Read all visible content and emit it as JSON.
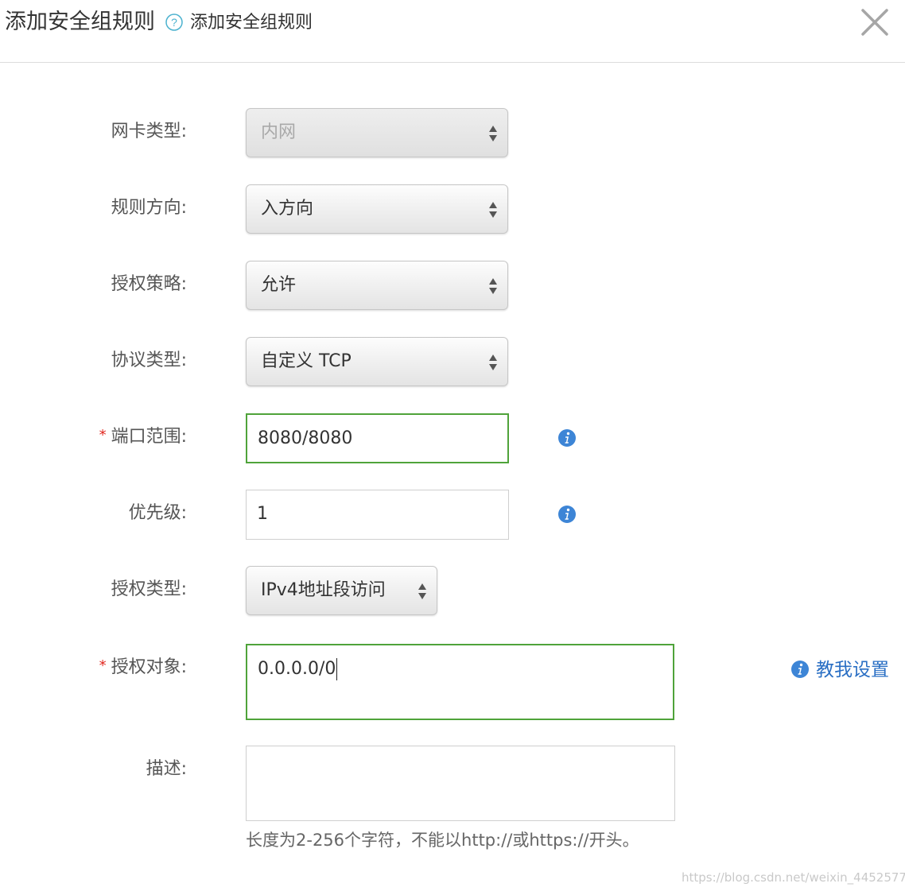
{
  "dialog": {
    "title": "添加安全组规则",
    "subtitle": "添加安全组规则",
    "help_icon": "question-circle-icon",
    "close_icon": "close-icon"
  },
  "form": {
    "nic_type": {
      "label": "网卡类型:",
      "value": "内网",
      "disabled": true
    },
    "direction": {
      "label": "规则方向:",
      "value": "入方向"
    },
    "policy": {
      "label": "授权策略:",
      "value": "允许"
    },
    "protocol": {
      "label": "协议类型:",
      "value": "自定义 TCP"
    },
    "port_range": {
      "label": "端口范围:",
      "required_mark": "*",
      "value": "8080/8080",
      "info_icon": "info-icon"
    },
    "priority": {
      "label": "优先级:",
      "value": "1",
      "info_icon": "info-icon"
    },
    "auth_type": {
      "label": "授权类型:",
      "value": "IPv4地址段访问"
    },
    "auth_object": {
      "label": "授权对象:",
      "required_mark": "*",
      "value": "0.0.0.0/0",
      "teach_link": "教我设置"
    },
    "description": {
      "label": "描述:",
      "value": "",
      "hint": "长度为2-256个字符，不能以http://或https://开头。"
    }
  },
  "watermark": "https://blog.csdn.net/weixin_44525772",
  "colors": {
    "valid_border": "#4fa33a",
    "link": "#2a6fc4",
    "info": "#3d85d6",
    "required": "#e0261e"
  }
}
